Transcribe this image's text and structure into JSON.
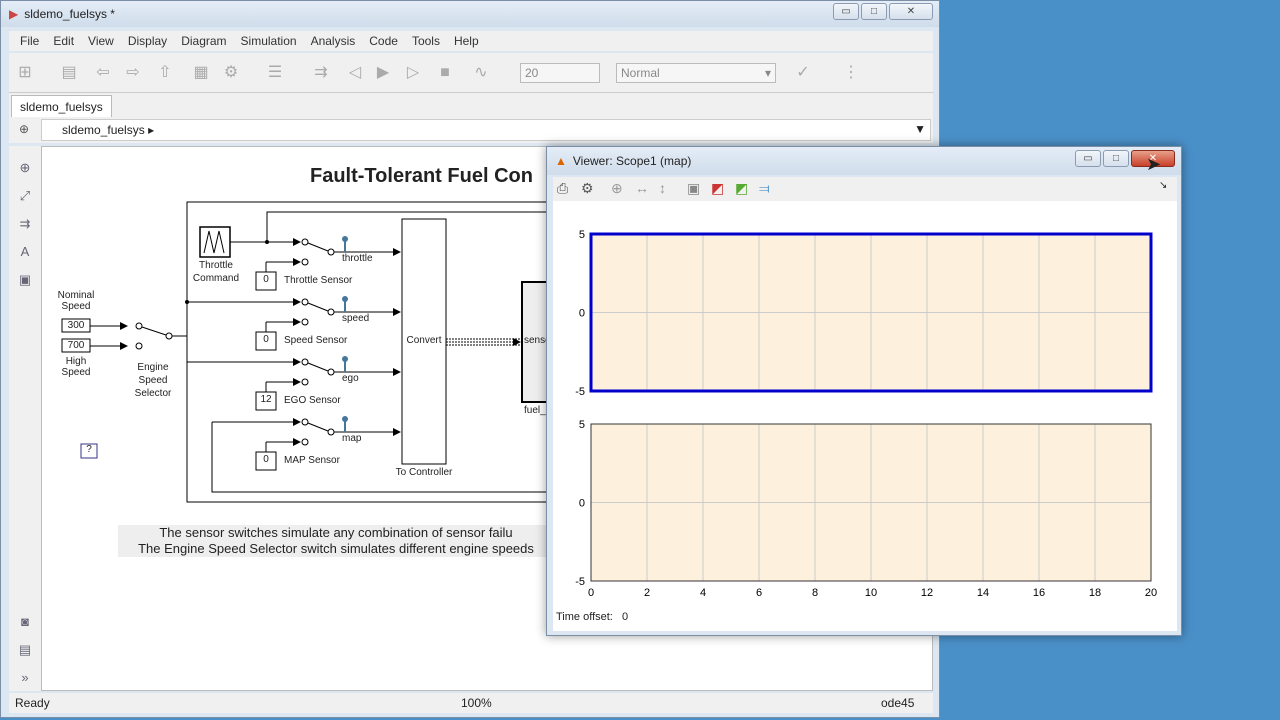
{
  "main_window": {
    "title": "sldemo_fuelsys *",
    "menu": [
      "File",
      "Edit",
      "View",
      "Display",
      "Diagram",
      "Simulation",
      "Analysis",
      "Code",
      "Tools",
      "Help"
    ],
    "toolbar": {
      "stop_time": "20",
      "sim_mode": "Normal"
    },
    "tab": "sldemo_fuelsys",
    "breadcrumb": "sldemo_fuelsys",
    "status": {
      "left": "Ready",
      "zoom": "100%",
      "solver": "ode45"
    }
  },
  "diagram": {
    "title": "Fault-Tolerant Fuel Con",
    "nominal_speed_label": "Nominal Speed",
    "nominal_speed": "300",
    "high_speed_label": "High Speed",
    "high_speed": "700",
    "engine_speed_selector": "Engine Speed Selector",
    "throttle_command": "Throttle Command",
    "sensors": [
      {
        "signal": "throttle",
        "label": "Throttle Sensor",
        "value": "0"
      },
      {
        "signal": "speed",
        "label": "Speed Sensor",
        "value": "0"
      },
      {
        "signal": "ego",
        "label": "EGO Sensor",
        "value": "12"
      },
      {
        "signal": "map",
        "label": "MAP Sensor",
        "value": "0"
      }
    ],
    "convert": "Convert",
    "to_controller": "To Controller",
    "sensors_port": "senso",
    "fuel_label": "fuel_",
    "help": "?",
    "annotation": [
      "The sensor switches simulate any combination of sensor failu",
      "The Engine Speed Selector switch simulates different engine speeds"
    ]
  },
  "scope_window": {
    "title": "Viewer: Scope1 (map)",
    "time_offset_label": "Time offset:",
    "time_offset": "0"
  },
  "chart_data": [
    {
      "type": "line",
      "xlim": [
        0,
        20
      ],
      "ylim": [
        -5,
        5
      ],
      "xticks": [
        "0",
        "2",
        "4",
        "6",
        "8",
        "10",
        "12",
        "14",
        "16",
        "18",
        "20"
      ],
      "yticks": [
        "5",
        "0",
        "-5"
      ],
      "grid": true,
      "series": [],
      "selected": true
    },
    {
      "type": "line",
      "xlim": [
        0,
        20
      ],
      "ylim": [
        -5,
        5
      ],
      "xticks": [
        "0",
        "2",
        "4",
        "6",
        "8",
        "10",
        "12",
        "14",
        "16",
        "18",
        "20"
      ],
      "yticks": [
        "5",
        "0",
        "-5"
      ],
      "grid": true,
      "series": []
    }
  ],
  "colors": {
    "plot_bg": "#fdf0dc",
    "selected_axes": "#0000cc",
    "desktop": "#4a90c8"
  }
}
